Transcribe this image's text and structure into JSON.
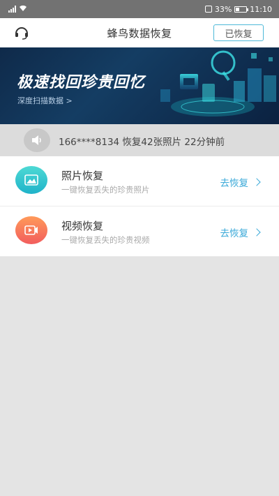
{
  "status_bar": {
    "network": "4G",
    "battery_pct": "33%",
    "time": "11:10"
  },
  "header": {
    "title": "蜂鸟数据恢复",
    "restored_label": "已恢复",
    "support_icon": "headset-icon"
  },
  "banner": {
    "title": "极速找回珍贵回忆",
    "subtitle": "深度扫描数据 >"
  },
  "ticker": {
    "icon": "speaker-icon",
    "text": "166****8134 恢复42张照片 22分钟前"
  },
  "items": [
    {
      "title": "照片恢复",
      "desc": "一键恢复丢失的珍贵照片",
      "action": "去恢复",
      "icon": "photo-icon"
    },
    {
      "title": "视频恢复",
      "desc": "一键恢复丢失的珍贵视频",
      "action": "去恢复",
      "icon": "video-icon"
    }
  ],
  "colors": {
    "accent": "#3aa9d8",
    "banner_bg": "#143d63",
    "photo_icon": "#1fb3c9",
    "video_icon": "#f25d5d"
  }
}
